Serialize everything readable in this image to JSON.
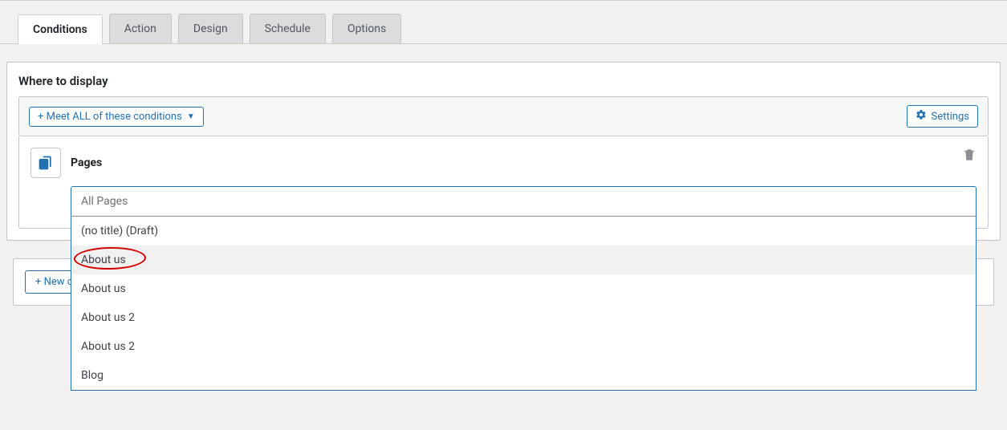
{
  "tabs": {
    "conditions": "Conditions",
    "action": "Action",
    "design": "Design",
    "schedule": "Schedule",
    "options": "Options"
  },
  "panel": {
    "title": "Where to display"
  },
  "condBar": {
    "meetAll": "+ Meet ALL of these conditions",
    "settings": "Settings"
  },
  "condition": {
    "type": "Pages",
    "placeholder": "All Pages"
  },
  "dropdown": {
    "items": [
      "(no title) (Draft)",
      "About us",
      "About us",
      "About us 2",
      "About us 2",
      "Blog"
    ]
  },
  "newCond": "+ New condition set"
}
